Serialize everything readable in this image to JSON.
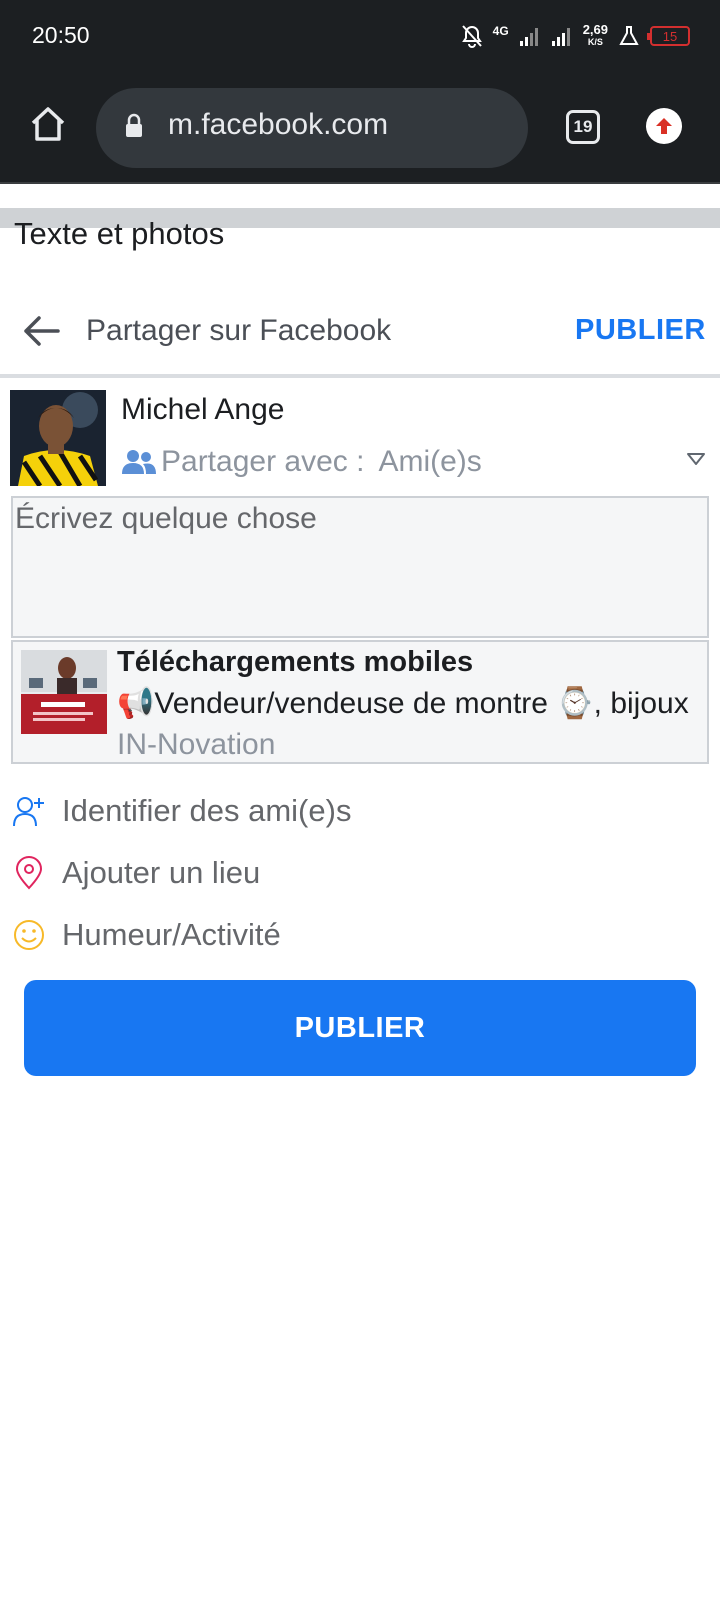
{
  "status_bar": {
    "time": "20:50",
    "network_type": "4G",
    "speed_value": "2,69",
    "speed_unit": "K/S",
    "battery": "15"
  },
  "browser": {
    "url": "m.facebook.com",
    "tab_count": "19"
  },
  "page": {
    "section_label": "Texte et photos",
    "header_title": "Partager sur Facebook",
    "header_publish": "PUBLIER"
  },
  "composer": {
    "user_name": "Michel Ange",
    "share_label": "Partager avec :",
    "share_value": "Ami(e)s",
    "placeholder": "Écrivez quelque chose"
  },
  "link_preview": {
    "title": "Téléchargements mobiles",
    "description": "📢Vendeur/vendeuse de montre ⌚, bijoux",
    "source": "IN-Novation"
  },
  "options": [
    {
      "label": "Identifier des ami(e)s",
      "icon": "tag-friends-icon",
      "color": "#1877f2"
    },
    {
      "label": "Ajouter un lieu",
      "icon": "location-pin-icon",
      "color": "#e0245e"
    },
    {
      "label": "Humeur/Activité",
      "icon": "smiley-icon",
      "color": "#f7b928"
    }
  ],
  "publish_button": "PUBLIER",
  "colors": {
    "accent": "#1877f2",
    "chrome_bg": "#1c1f22",
    "battery_low": "#d32f2f"
  }
}
